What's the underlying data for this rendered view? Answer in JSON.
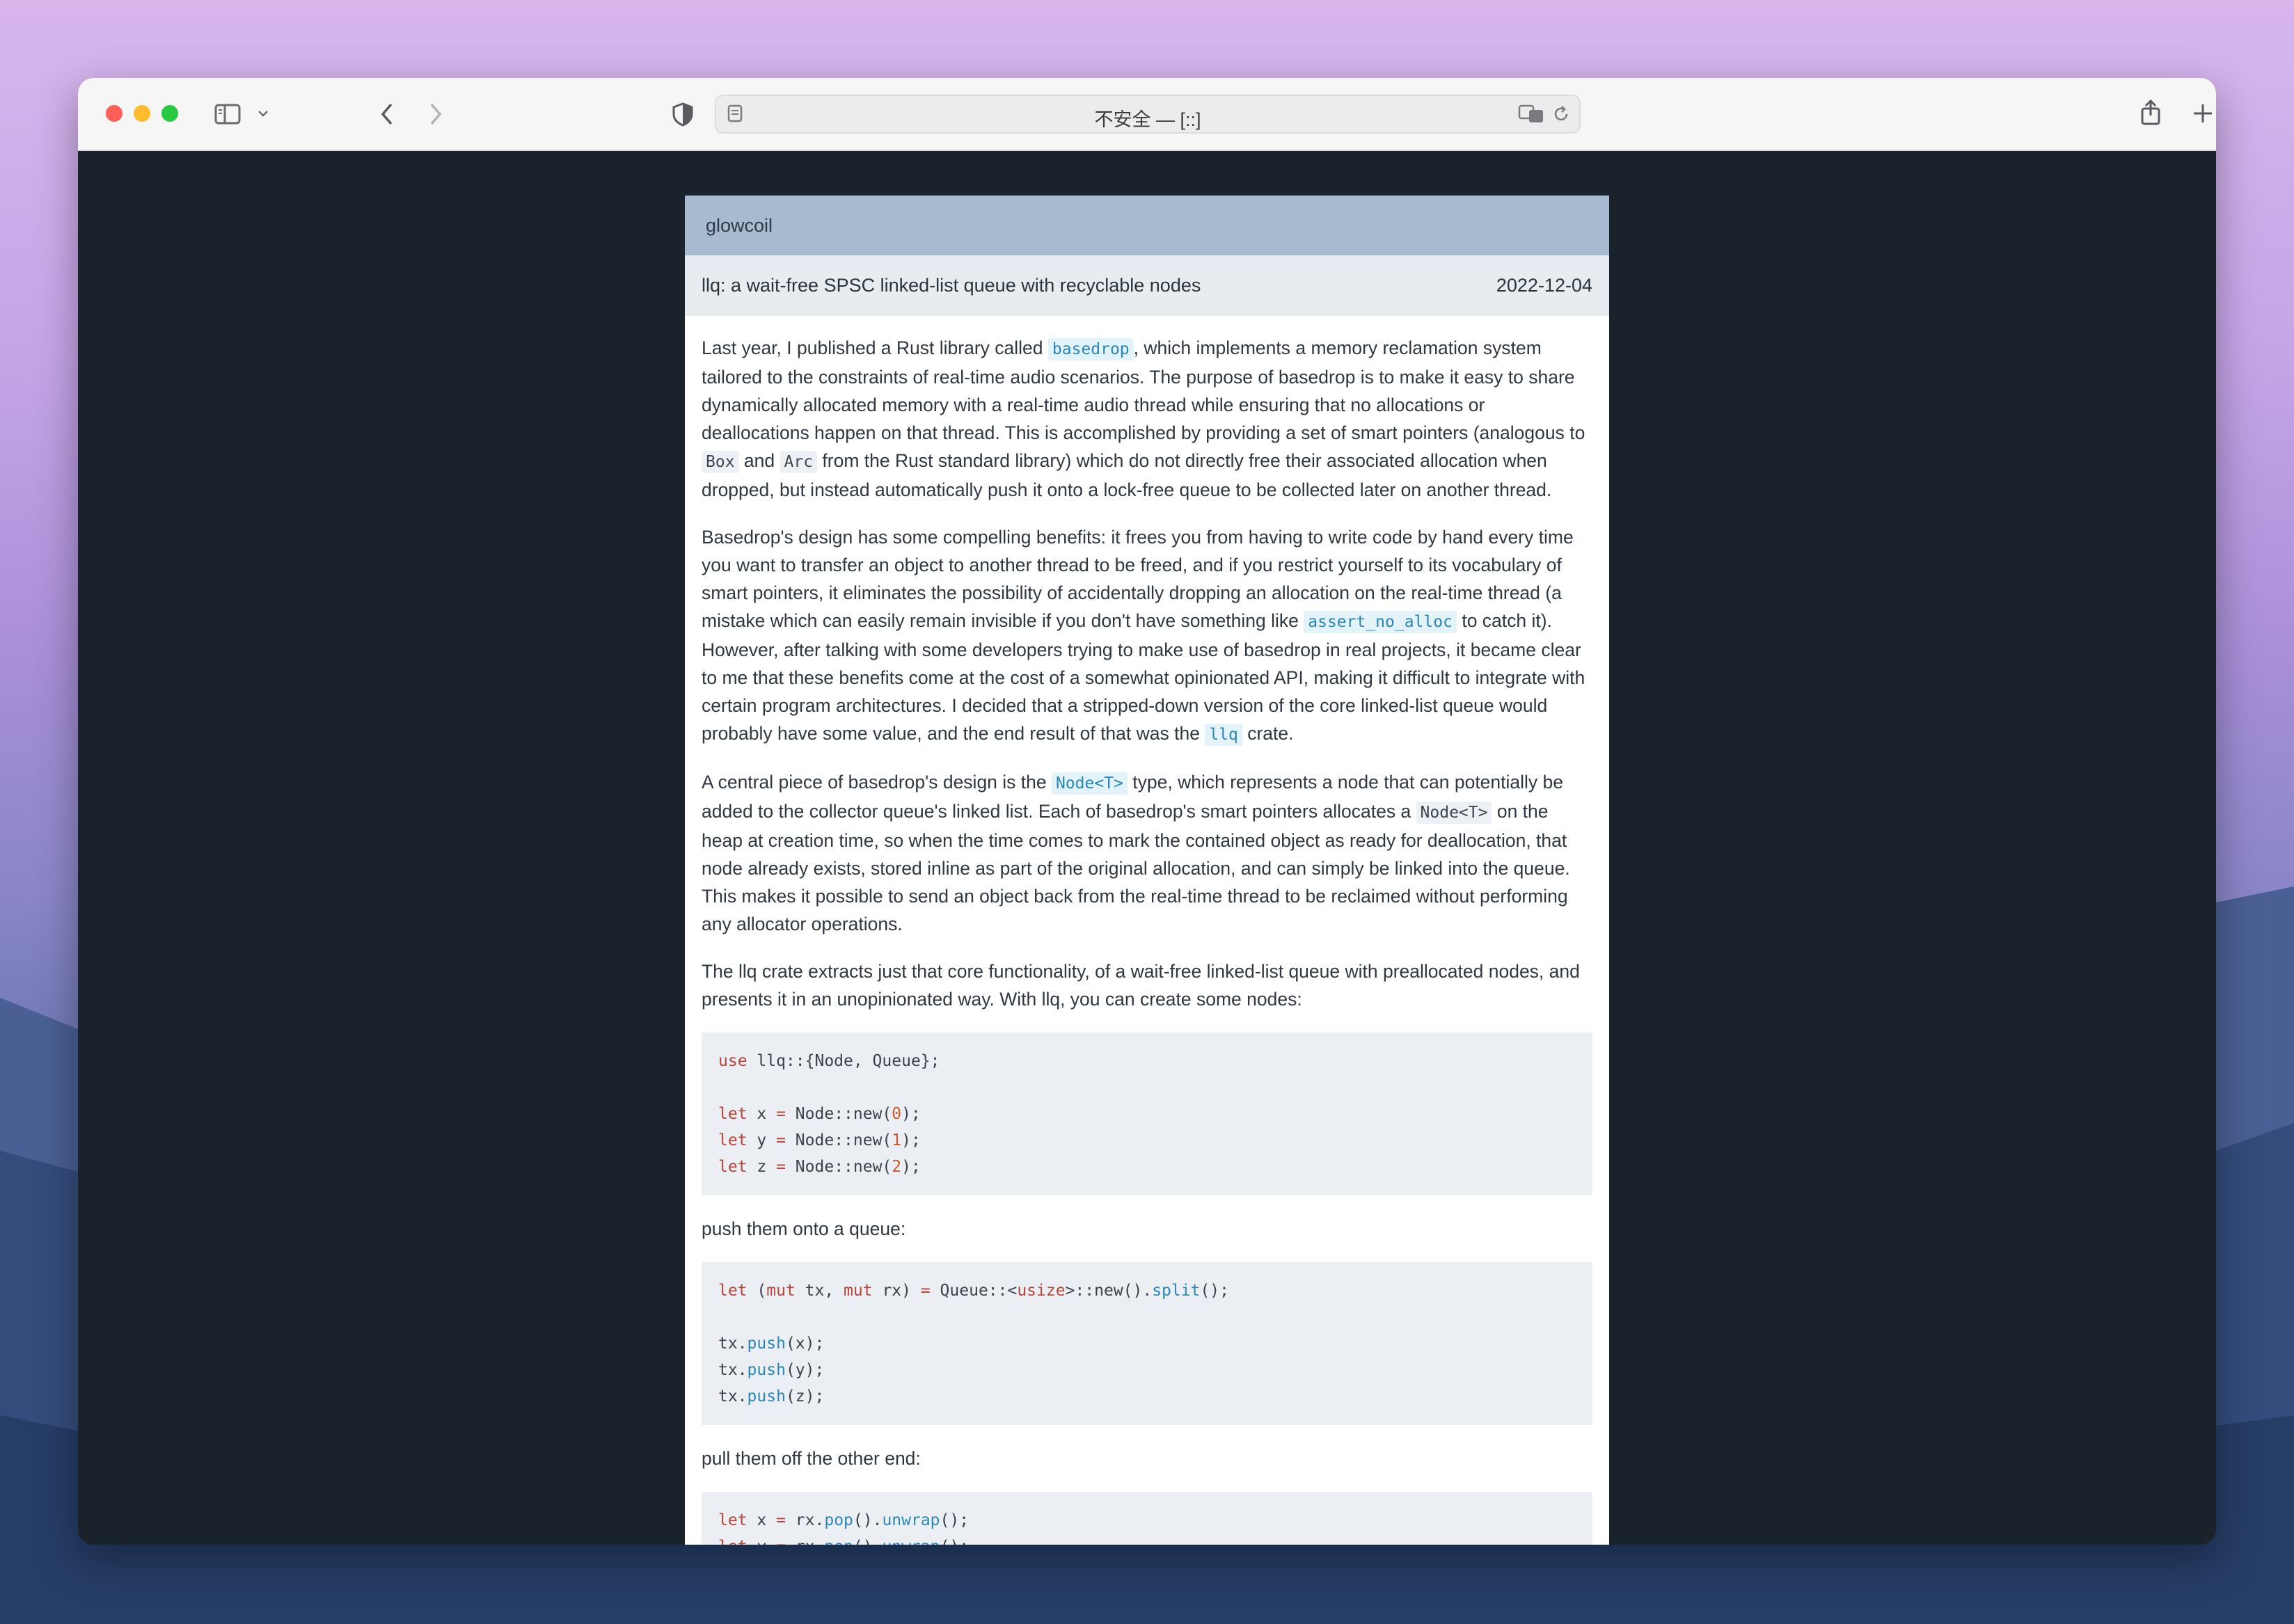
{
  "browser": {
    "url_text": "不安全 — [::]"
  },
  "site": {
    "name": "glowcoil"
  },
  "post": {
    "title": "llq: a wait-free SPSC linked-list queue with recyclable nodes",
    "date": "2022-12-04",
    "p1": {
      "a": "Last year, I published a Rust library called ",
      "link_basedrop": "basedrop",
      "b": ", which implements a memory reclamation system tailored to the constraints of real-time audio scenarios. The purpose of basedrop is to make it easy to share dynamically allocated memory with a real-time audio thread while ensuring that no allocations or deallocations happen on that thread. This is accomplished by providing a set of smart pointers (analogous to ",
      "code_box": "Box",
      "c": " and ",
      "code_arc": "Arc",
      "d": " from the Rust standard library) which do not directly free their associated allocation when dropped, but instead automatically push it onto a lock-free queue to be collected later on another thread."
    },
    "p2": {
      "a": "Basedrop's design has some compelling benefits: it frees you from having to write code by hand every time you want to transfer an object to another thread to be freed, and if you restrict yourself to its vocabulary of smart pointers, it eliminates the possibility of accidentally dropping an allocation on the real-time thread (a mistake which can easily remain invisible if you don't have something like ",
      "link_assert": "assert_no_alloc",
      "b": " to catch it). However, after talking with some developers trying to make use of basedrop in real projects, it became clear to me that these benefits come at the cost of a somewhat opinionated API, making it difficult to integrate with certain program architectures. I decided that a stripped-down version of the core linked-list queue would probably have some value, and the end result of that was the ",
      "link_llq": "llq",
      "c": " crate."
    },
    "p3": {
      "a": "A central piece of basedrop's design is the ",
      "link_node": "Node<T>",
      "b": " type, which represents a node that can potentially be added to the collector queue's linked list. Each of basedrop's smart pointers allocates a ",
      "code_node": "Node<T>",
      "c": " on the heap at creation time, so when the time comes to mark the contained object as ready for deallocation, that node already exists, stored inline as part of the original allocation, and can simply be linked into the queue. This makes it possible to send an object back from the real-time thread to be reclaimed without performing any allocator operations."
    },
    "p4": "The llq crate extracts just that core functionality, of a wait-free linked-list queue with preallocated nodes, and presents it in an unopinionated way. With llq, you can create some nodes:",
    "p5": "push them onto a queue:",
    "p6": "pull them off the other end:"
  },
  "code": {
    "block1": {
      "l1_kw": "use",
      "l1_rest": " llq::{Node, Queue};",
      "l3_kw": "let",
      "l3_a": " x ",
      "l3_eq": "=",
      "l3_b": " Node::new(",
      "l3_n": "0",
      "l3_c": ");",
      "l4_kw": "let",
      "l4_a": " y ",
      "l4_eq": "=",
      "l4_b": " Node::new(",
      "l4_n": "1",
      "l4_c": ");",
      "l5_kw": "let",
      "l5_a": " z ",
      "l5_eq": "=",
      "l5_b": " Node::new(",
      "l5_n": "2",
      "l5_c": ");"
    },
    "block2": {
      "l1_kw": "let",
      "l1_a": " (",
      "l1_mut1": "mut",
      "l1_b": " tx, ",
      "l1_mut2": "mut",
      "l1_c": " rx) ",
      "l1_eq": "=",
      "l1_d": " Queue::<",
      "l1_ty": "usize",
      "l1_e": ">::new().",
      "l1_fn": "split",
      "l1_f": "();",
      "l3_a": "tx.",
      "l3_fn": "push",
      "l3_b": "(x);",
      "l4_a": "tx.",
      "l4_fn": "push",
      "l4_b": "(y);",
      "l5_a": "tx.",
      "l5_fn": "push",
      "l5_b": "(z);"
    },
    "block3": {
      "l1_kw": "let",
      "l1_a": " x ",
      "l1_eq": "=",
      "l1_b": " rx.",
      "l1_fn1": "pop",
      "l1_c": "().",
      "l1_fn2": "unwrap",
      "l1_d": "();",
      "l2_kw": "let",
      "l2_a": " y ",
      "l2_eq": "=",
      "l2_b": " rx.",
      "l2_fn1": "pop",
      "l2_c": "().",
      "l2_fn2": "unwrap",
      "l2_d": "();"
    }
  }
}
